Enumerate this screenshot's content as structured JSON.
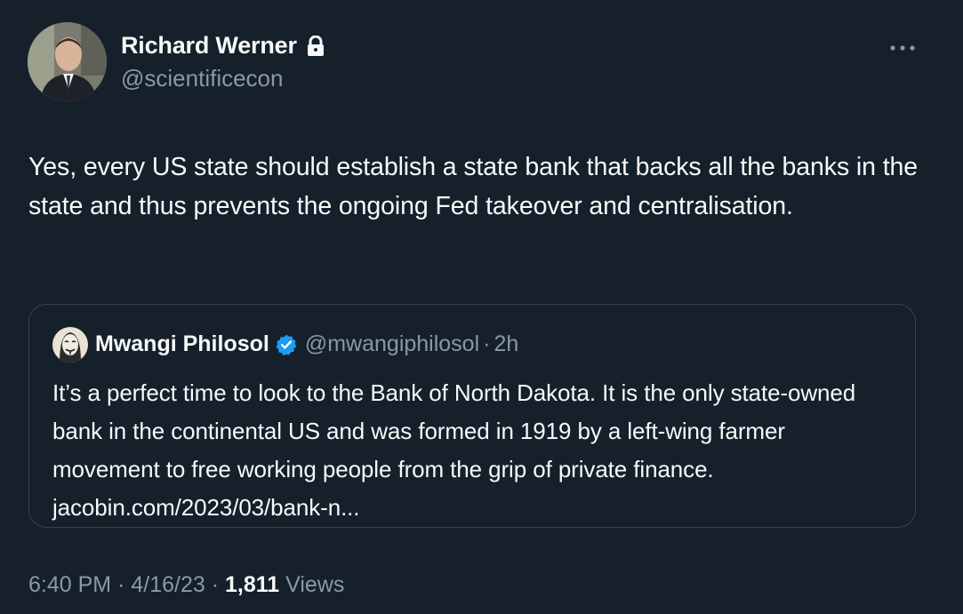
{
  "author": {
    "name": "Richard Werner",
    "handle": "@scientificecon",
    "protected_icon": "lock-icon"
  },
  "tweet": {
    "text": "Yes, every US state should establish a state bank that backs all the banks in the state and thus prevents the ongoing Fed takeover and centralisation."
  },
  "quoted_tweet": {
    "name": "Mwangi Philosol",
    "verified_icon": "verified-badge-icon",
    "handle": "@mwangiphilosol",
    "separator": "·",
    "time": "2h",
    "text": "It’s a perfect time to look to the Bank of North Dakota. It is the only state-owned bank in the continental US and was formed in 1919 by a left-wing farmer movement to free working people from the grip of private finance.",
    "link": "jacobin.com/2023/03/bank-n..."
  },
  "meta": {
    "time": "6:40 PM",
    "separator": "·",
    "date": "4/16/23",
    "views_count": "1,811",
    "views_label": "Views"
  },
  "colors": {
    "background": "#15202b",
    "text": "#f7f9f9",
    "secondary": "#8b98a5",
    "verified": "#1d9bf0",
    "border": "#38444d"
  },
  "icons": {
    "more": "more-options-icon"
  }
}
